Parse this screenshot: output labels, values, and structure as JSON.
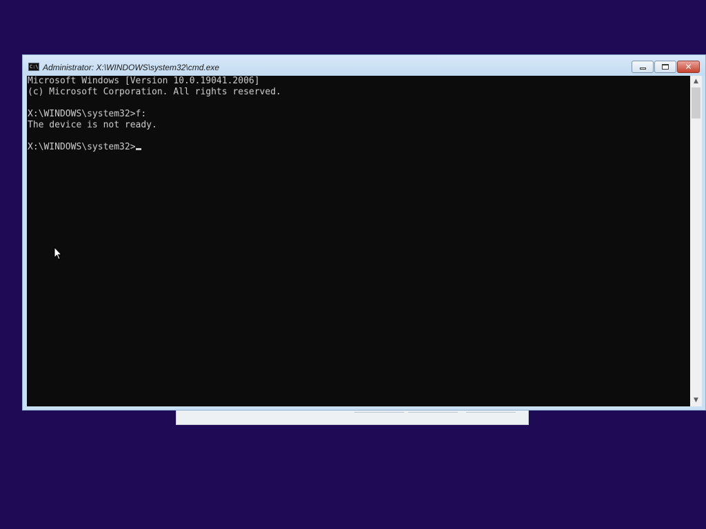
{
  "window": {
    "title": "Administrator: X:\\WINDOWS\\system32\\cmd.exe",
    "icon_text": "C:\\",
    "buttons": {
      "minimize_icon": "minimize-icon",
      "maximize_icon": "restore-icon",
      "close_glyph": "✕"
    }
  },
  "console": {
    "lines": [
      "Microsoft Windows [Version 10.0.19041.2006]",
      "(c) Microsoft Corporation. All rights reserved.",
      "",
      "X:\\WINDOWS\\system32>f:",
      "The device is not ready.",
      "",
      "X:\\WINDOWS\\system32>"
    ],
    "text_color": "#cccccc",
    "background_color": "#0c0c0c"
  },
  "scrollbar": {
    "up_arrow": "▲",
    "down_arrow": "▼"
  },
  "desktop": {
    "background_color": "#1f0a55"
  }
}
